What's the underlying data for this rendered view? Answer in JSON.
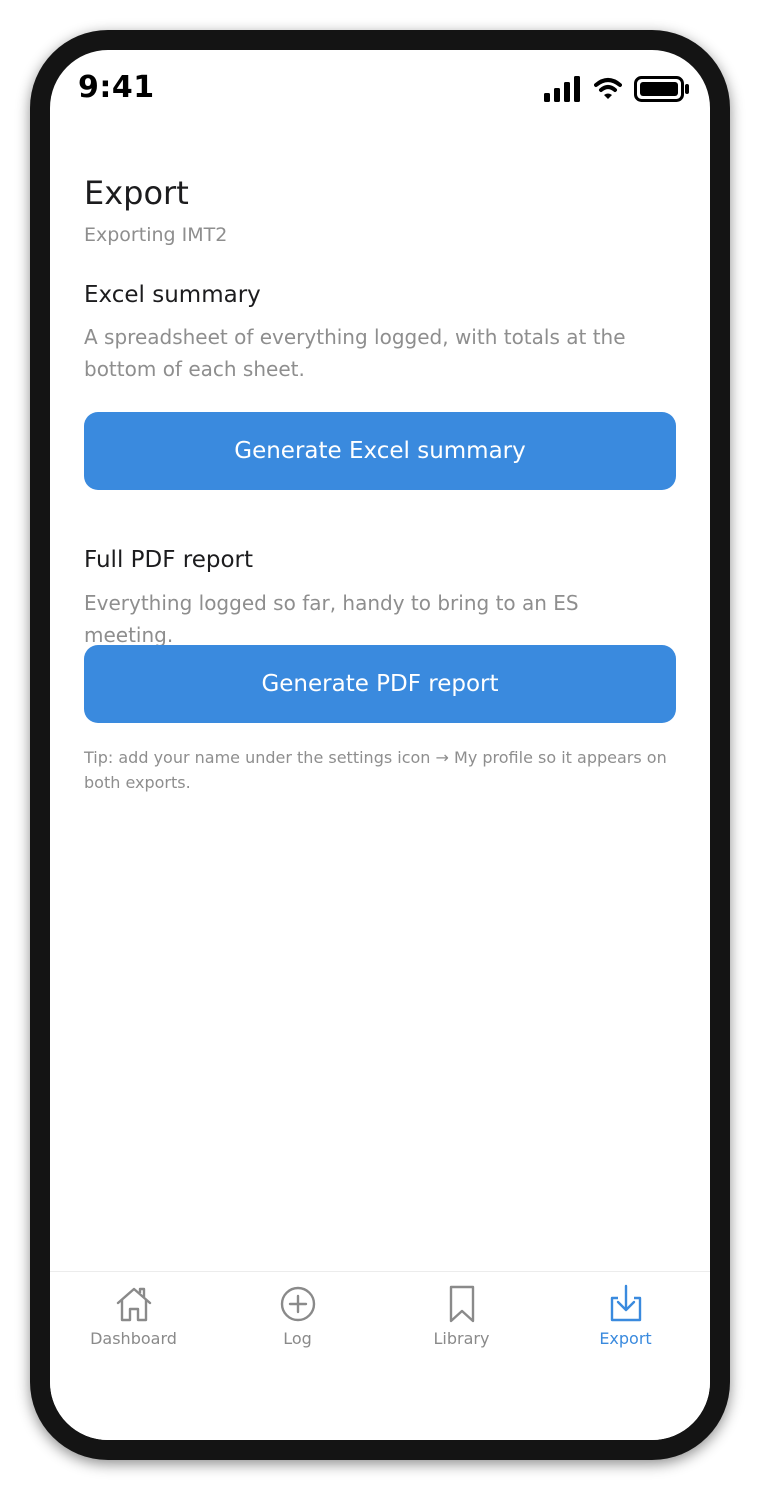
{
  "status_bar": {
    "time": "9:41",
    "icons": [
      "cellular-signal-icon",
      "wifi-icon",
      "battery-icon"
    ]
  },
  "header": {
    "title": "Export",
    "subtitle": "Exporting IMT2"
  },
  "excel_section": {
    "heading": "Excel summary",
    "description": "A spreadsheet of everything logged, with totals at the bottom of each sheet.",
    "button_label": "Generate Excel summary"
  },
  "pdf_section": {
    "heading": "Full PDF report",
    "description": "Everything logged so far, handy to bring to an ES meeting.",
    "button_label": "Generate PDF report"
  },
  "tip": "Tip: add your name under the settings icon → My profile so it appears on both exports.",
  "tab_bar": {
    "tabs": [
      {
        "label": "Dashboard",
        "icon": "home-icon",
        "active": false
      },
      {
        "label": "Log",
        "icon": "plus-circle-icon",
        "active": false
      },
      {
        "label": "Library",
        "icon": "bookmark-icon",
        "active": false
      },
      {
        "label": "Export",
        "icon": "download-tray-icon",
        "active": true
      }
    ]
  },
  "colors": {
    "accent": "#3a8ade",
    "inactive_tab": "#8a8a8a",
    "secondary_text": "#8e8e8e",
    "primary_text": "#1c1c1e"
  }
}
